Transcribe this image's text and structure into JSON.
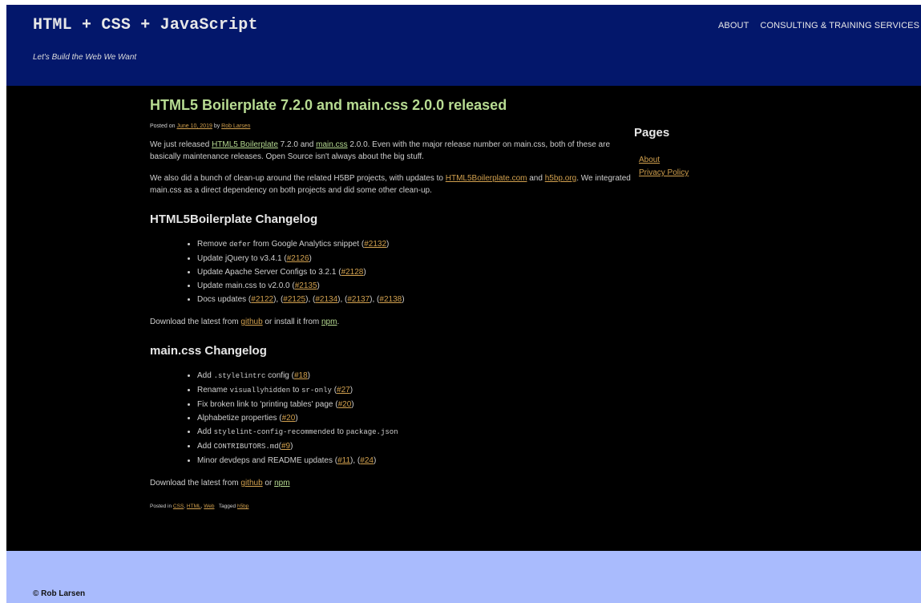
{
  "header": {
    "site_title": "HTML + CSS + JavaScript",
    "tagline": "Let's Build the Web We Want",
    "nav": [
      "ABOUT",
      "CONSULTING & TRAINING SERVICES"
    ]
  },
  "article": {
    "title": "HTML5 Boilerplate 7.2.0 and main.css 2.0.0 released",
    "meta": {
      "posted_on": "Posted on",
      "date": "June 10, 2019",
      "by": "by",
      "author": "Rob Larsen"
    },
    "p1": {
      "t1": "We just released ",
      "link1": "HTML5 Boilerplate",
      "t2": " 7.2.0 and ",
      "link2": "main.css",
      "t3": " 2.0.0. Even with the major release number on main.css, both of these are basically maintenance releases. Open Source isn't always about the big stuff."
    },
    "p2": {
      "t1": "We also did a bunch of clean-up around the related H5BP projects, with updates to ",
      "link1": "HTML5Boilerplate.com",
      "t2": " and ",
      "link2": "h5bp.org",
      "t3": ". We integrated main.css as a direct dependency on both projects and did some other clean-up."
    },
    "h5bp_changelog": {
      "heading": "HTML5Boilerplate Changelog",
      "items": [
        {
          "pre": "Remove ",
          "code": "defer",
          "post": " from Google Analytics snippet (",
          "link": "#2132",
          "end": ")"
        },
        {
          "pre": "Update jQuery to v3.4.1 (",
          "link": "#2126",
          "end": ")"
        },
        {
          "pre": "Update Apache Server Configs to 3.2.1 (",
          "link": "#2128",
          "end": ")"
        },
        {
          "pre": "Update main.css to v2.0.0 (",
          "link": "#2135",
          "end": ")"
        },
        {
          "pre": "Docs updates (",
          "links": [
            "#2122",
            "#2125",
            "#2134",
            "#2137",
            "#2138"
          ]
        }
      ],
      "download": {
        "t1": "Download the latest from ",
        "link1": "github",
        "t2": " or install it from ",
        "link2": "npm",
        "t3": "."
      }
    },
    "maincss_changelog": {
      "heading": "main.css Changelog",
      "items": [
        {
          "pre": "Add ",
          "code": ".stylelintrc",
          "post": " config (",
          "link": "#18",
          "end": ")"
        },
        {
          "pre": "Rename ",
          "code": "visuallyhidden",
          "mid": " to ",
          "code2": "sr-only",
          "post": " (",
          "link": "#27",
          "end": ")"
        },
        {
          "pre": "Fix broken link to 'printing tables' page (",
          "link": "#20",
          "end": ")"
        },
        {
          "pre": "Alphabetize properties (",
          "link": "#20",
          "end": ")"
        },
        {
          "pre": "Add ",
          "code": "stylelint-config-recommended",
          "mid": " to ",
          "code2": "package.json"
        },
        {
          "pre": "Add ",
          "code": "CONTRIBUTORS.md",
          "post": "(",
          "link": "#9",
          "end": ")"
        },
        {
          "pre": "Minor devdeps and README updates (",
          "links": [
            "#11",
            "#24"
          ]
        }
      ],
      "download": {
        "t1": "Download the latest from ",
        "link1": "github",
        "t2": " or ",
        "link2": "npm"
      }
    },
    "footer_meta": {
      "posted_in": "Posted in ",
      "cats": [
        "CSS",
        "HTML",
        "Web"
      ],
      "tagged": "Tagged ",
      "tag": "h5bp"
    }
  },
  "sidebar": {
    "title": "Pages",
    "items": [
      "About",
      "Privacy Policy"
    ]
  },
  "footer": {
    "copyright": "© Rob Larsen"
  },
  "colors": {
    "header_bg": "#03176b",
    "main_bg": "#000000",
    "footer_bg": "#a9bbfd",
    "title_green": "#b7db92",
    "link_orange": "#d1a04e"
  }
}
